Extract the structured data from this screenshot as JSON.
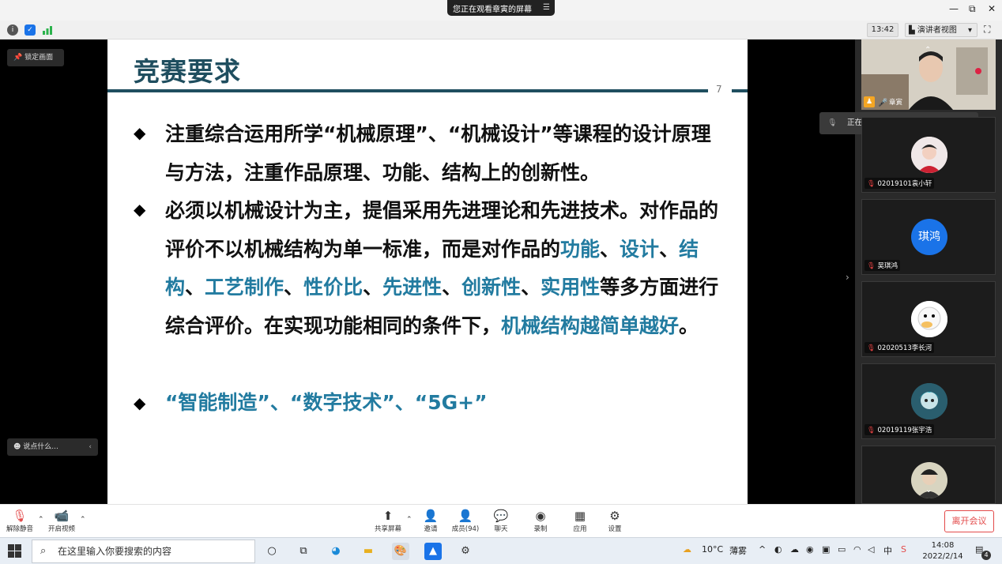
{
  "titlebar": {
    "viewing_text": "您正在观看章寅的屏幕",
    "minimize": "—",
    "restore": "⧉",
    "close": "✕"
  },
  "toolbar": {
    "time": "13:42",
    "view_mode": "演讲者视图",
    "view_caret": "▾"
  },
  "share": {
    "lock_label": "锁定画面",
    "chat_placeholder": "说点什么...",
    "chat_arrow": "‹"
  },
  "slide": {
    "title": "竞赛要求",
    "page_number": "7",
    "bullet_char": "◆",
    "p1": "注重综合运用所学“机械原理”、“机械设计”等课程的设计原理与方法，注重作品原理、功能、结构上的创新性。",
    "p2_a": "必须以机械设计为主，提倡采用先进理论和先进技术。对作品的评价不以机械结构为单一标准，而是对作品的",
    "p2_h1": "功能",
    "sep": "、",
    "p2_h2": "设计",
    "p2_h3": "结构",
    "p2_h4": "工艺制作",
    "p2_h5": "性价比",
    "p2_h6": "先进性",
    "p2_h7": "创新性",
    "p2_h8": "实用性",
    "p2_b": "等多方面进行综合评价。在实现功能相同的条件下，",
    "p2_h9": "机械结构越简单越好",
    "p2_end": "。",
    "p3_h1": "“智能制造”",
    "p3_h2": "“数字技术”",
    "p3_h3": "“5G+”"
  },
  "participants": {
    "host_name": "章寅",
    "speaking_text": "正在讲话: 章寅;",
    "tiles": [
      {
        "name": "02019101袁小轩",
        "avatar_text": ""
      },
      {
        "name": "吴琪鸿",
        "avatar_text": "琪鸿"
      },
      {
        "name": "02020513李长河",
        "avatar_text": ""
      },
      {
        "name": "02019119张宇浩",
        "avatar_text": ""
      }
    ]
  },
  "bottombar": {
    "mute": "解除静音",
    "video": "开启视频",
    "share": "共享屏幕",
    "invite": "邀请",
    "members": "成员(94)",
    "chat": "聊天",
    "record": "录制",
    "apps": "应用",
    "settings": "设置",
    "leave": "离开会议"
  },
  "taskbar": {
    "search_placeholder": "在这里输入你要搜索的内容",
    "weather_temp": "10°C",
    "weather_desc": "薄雾",
    "ime": "中",
    "time": "14:08",
    "date": "2022/2/14",
    "notif_count": "4"
  },
  "colors": {
    "title_blue": "#1f4e5f",
    "highlight_blue": "#227ba0",
    "leave_red": "#e34a4a"
  }
}
